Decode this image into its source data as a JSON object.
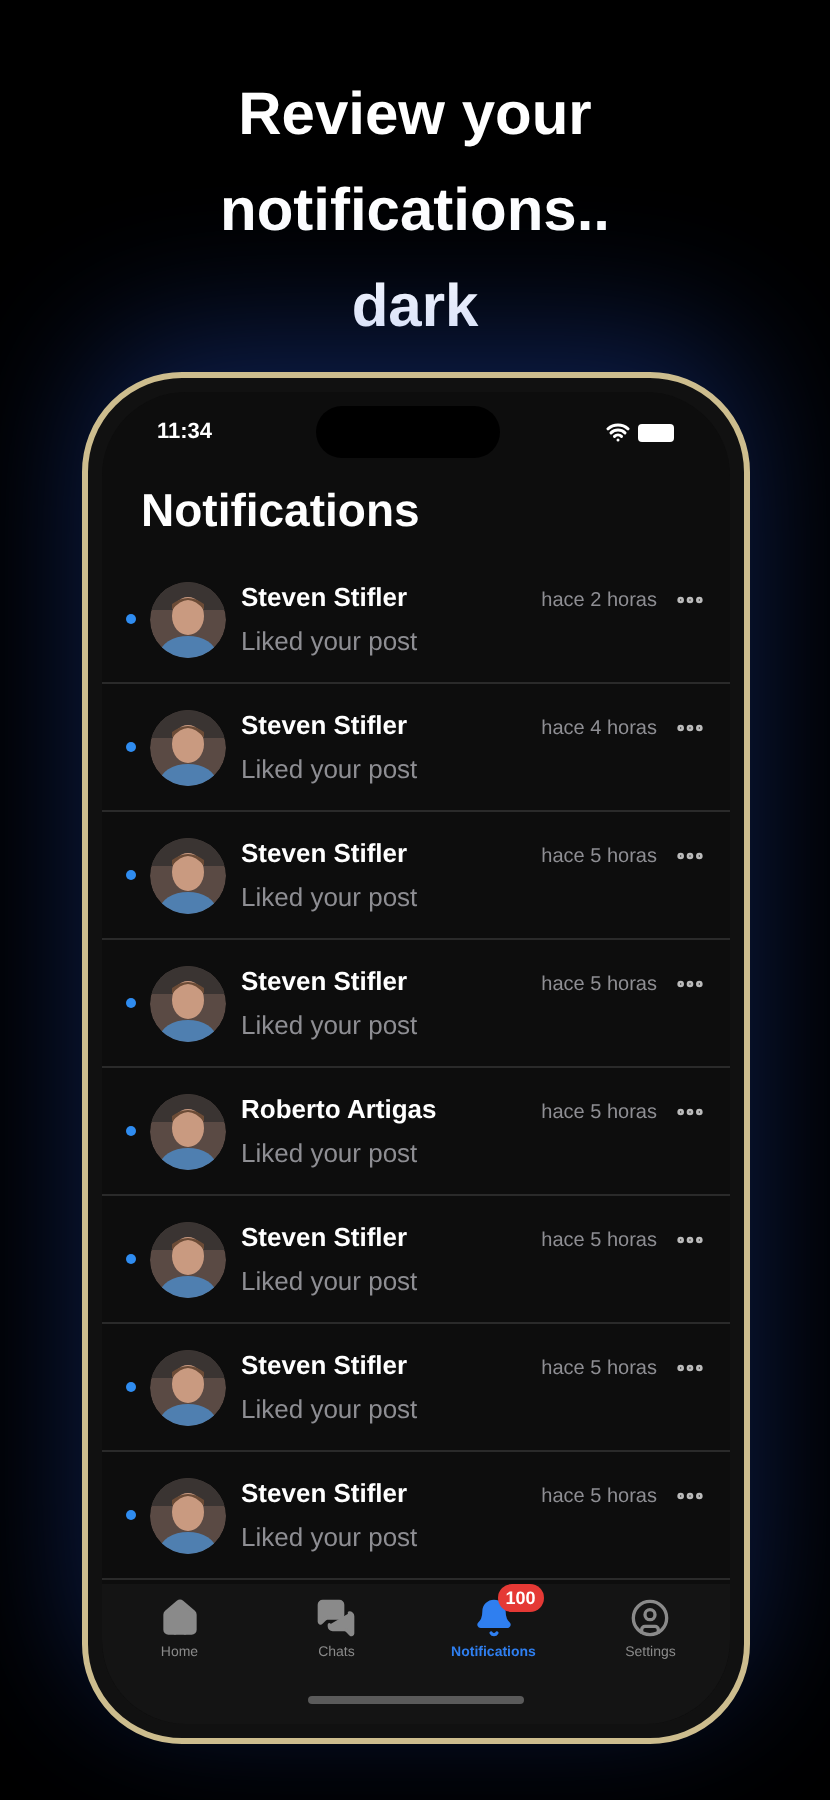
{
  "header": {
    "title_lines": [
      "Review your",
      "notifications..",
      "dark"
    ]
  },
  "status_bar": {
    "time": "11:34"
  },
  "screen": {
    "title": "Notifications"
  },
  "notifications": [
    {
      "name": "Steven Stifler",
      "action": "Liked your post",
      "time": "hace 2 horas",
      "unread": true
    },
    {
      "name": "Steven Stifler",
      "action": "Liked your post",
      "time": "hace 4 horas",
      "unread": true
    },
    {
      "name": "Steven Stifler",
      "action": "Liked your post",
      "time": "hace 5 horas",
      "unread": true
    },
    {
      "name": "Steven Stifler",
      "action": "Liked your post",
      "time": "hace 5 horas",
      "unread": true
    },
    {
      "name": "Roberto Artigas",
      "action": "Liked your post",
      "time": "hace 5 horas",
      "unread": true
    },
    {
      "name": "Steven Stifler",
      "action": "Liked your post",
      "time": "hace 5 horas",
      "unread": true
    },
    {
      "name": "Steven Stifler",
      "action": "Liked your post",
      "time": "hace 5 horas",
      "unread": true
    },
    {
      "name": "Steven Stifler",
      "action": "Liked your post",
      "time": "hace 5 horas",
      "unread": true
    }
  ],
  "tab_bar": [
    {
      "kind": "home",
      "label": "Home",
      "selected": false
    },
    {
      "kind": "chats",
      "label": "Chats",
      "selected": false
    },
    {
      "kind": "notifications",
      "label": "Notifications",
      "badge": "100",
      "selected": true
    },
    {
      "kind": "settings",
      "label": "Settings",
      "selected": false
    }
  ]
}
